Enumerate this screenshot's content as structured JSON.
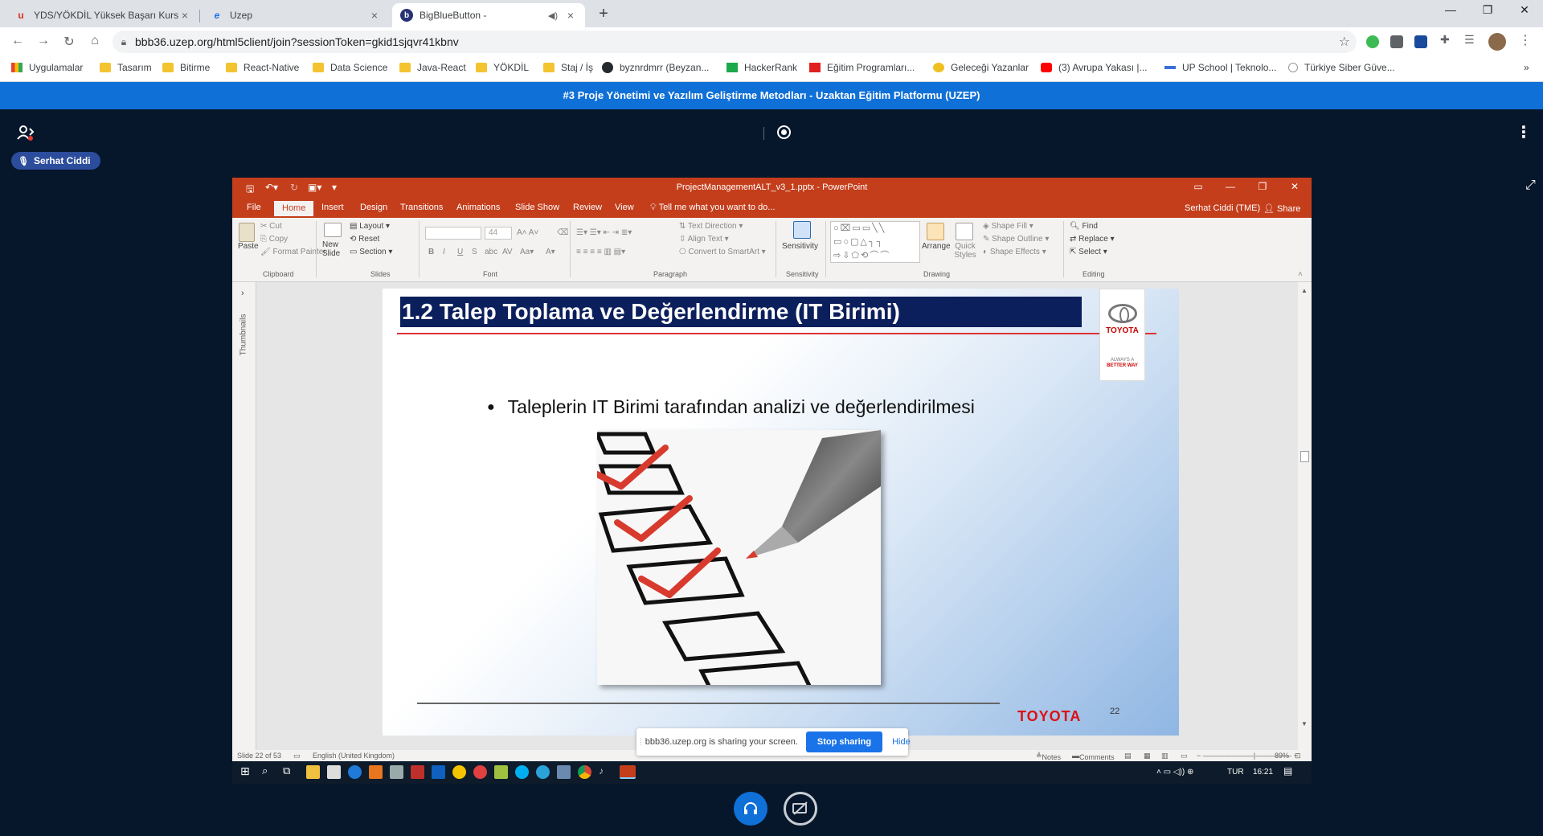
{
  "browser": {
    "tabs": [
      {
        "title": "YDS/YÖKDİL Yüksek Başarı Kursu",
        "favicon": "u-logo-icon"
      },
      {
        "title": "Uzep",
        "favicon": "ie-icon"
      },
      {
        "title": "BigBlueButton -",
        "favicon": "bbb-icon"
      }
    ],
    "url": "bbb36.uzep.org/html5client/join?sessionToken=gkid1sjqvr41kbnv",
    "bookmarks": [
      "Uygulamalar",
      "Tasarım",
      "Bitirme",
      "React-Native",
      "Data Science",
      "Java-React",
      "YÖKDİL",
      "Staj / İş",
      "byznrdmrr (Beyzan...",
      "HackerRank",
      "Eğitim Programları...",
      "Geleceği Yazanlar",
      "(3) Avrupa Yakası |...",
      "UP School | Teknolo...",
      "Türkiye Siber Güve..."
    ],
    "bookmarks_more": "»"
  },
  "bbb": {
    "banner": "#3 Proje Yönetimi ve Yazılım Geliştirme Metodları - Uzaktan Eğitim Platformu (UZEP)",
    "user_name": "Serhat Ciddi",
    "share_notice": {
      "message": "bbb36.uzep.org is sharing your screen.",
      "stop": "Stop sharing",
      "hide": "Hide"
    }
  },
  "ppt": {
    "filename": "ProjectManagementALT_v3_1.pptx - PowerPoint",
    "tabs": [
      "File",
      "Home",
      "Insert",
      "Design",
      "Transitions",
      "Animations",
      "Slide Show",
      "Review",
      "View"
    ],
    "tell_me": "Tell me what you want to do...",
    "user": "Serhat Ciddi (TME)",
    "share": "Share",
    "ribbon": {
      "cut": "Cut",
      "copy": "Copy",
      "format_painter": "Format Painter",
      "paste": "Paste",
      "new_slide": "New Slide",
      "layout": "Layout",
      "reset": "Reset",
      "section": "Section",
      "font_size": "44",
      "text_direction": "Text Direction",
      "align_text": "Align Text",
      "convert_smartart": "Convert to SmartArt",
      "sensitivity": "Sensitivity",
      "arrange": "Arrange",
      "quick_styles": "Quick Styles",
      "shape_fill": "Shape Fill",
      "shape_outline": "Shape Outline",
      "shape_effects": "Shape Effects",
      "find": "Find",
      "replace": "Replace",
      "select": "Select",
      "groups": [
        "Clipboard",
        "Slides",
        "Font",
        "Paragraph",
        "Sensitivity",
        "Drawing",
        "Editing"
      ]
    },
    "thumbnails_label": "Thumbnails",
    "slide": {
      "title": "1.2 Talep Toplama ve Değerlendirme (IT Birimi)",
      "bullet": "Taleplerin IT Birimi tarafından analizi ve değerlendirilmesi",
      "logo_brand": "TOYOTA",
      "logo_tag_1": "ALWAYS A",
      "logo_tag_2": "BETTER WAY",
      "footer_brand": "TOYOTA",
      "number": "22"
    },
    "status": {
      "slide": "Slide 22 of 53",
      "language": "English (United Kingdom)",
      "notes": "Notes",
      "comments": "Comments",
      "zoom": "89%"
    }
  },
  "windows_taskbar": {
    "lang": "TUR",
    "time": "16:21"
  }
}
